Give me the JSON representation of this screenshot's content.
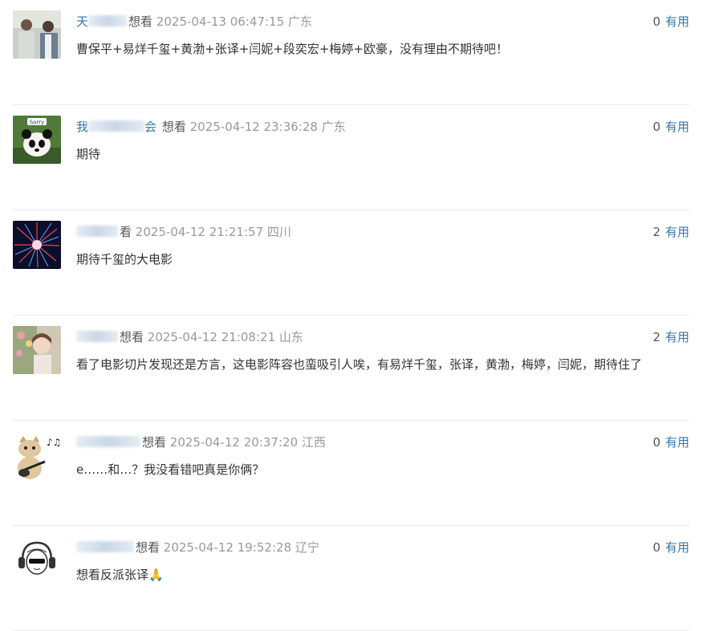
{
  "comments": [
    {
      "user_visible": "天",
      "rating": "想看",
      "time": "2025-04-13 06:47:15",
      "location": "广东",
      "votes": "0",
      "useful_label": "有用",
      "content": "曹保平+易烊千玺+黄渤+张译+闫妮+段奕宏+梅婷+欧豪，没有理由不期待吧！",
      "avatar_icon": "two-men-photo-icon"
    },
    {
      "user_visible": "我",
      "user_tail": "会",
      "rating": "想看",
      "time": "2025-04-12 23:36:28",
      "location": "广东",
      "votes": "0",
      "useful_label": "有用",
      "content": "期待",
      "avatar_icon": "panda-sorry-icon"
    },
    {
      "user_visible": "",
      "rating": "看",
      "time": "2025-04-12 21:21:57",
      "location": "四川",
      "votes": "2",
      "useful_label": "有用",
      "content": "期待千玺的大电影",
      "avatar_icon": "firework-burst-icon"
    },
    {
      "user_visible": "",
      "rating": "想看",
      "time": "2025-04-12 21:08:21",
      "location": "山东",
      "votes": "2",
      "useful_label": "有用",
      "content": "看了电影切片发现还是方言，这电影阵容也蛮吸引人唉，有易烊千玺，张译，黄渤，梅婷，闫妮，期待住了",
      "avatar_icon": "woman-flowers-icon"
    },
    {
      "user_visible": "",
      "rating": "想看",
      "time": "2025-04-12 20:37:20",
      "location": "江西",
      "votes": "0",
      "useful_label": "有用",
      "content": "e……和…？我没看错吧真是你俩？",
      "avatar_icon": "cat-guitar-icon"
    },
    {
      "user_visible": "",
      "rating": "想看",
      "time": "2025-04-12 19:52:28",
      "location": "辽宁",
      "votes": "0",
      "useful_label": "有用",
      "content": "想看反派张译🙏",
      "avatar_icon": "headphone-girl-icon"
    }
  ]
}
